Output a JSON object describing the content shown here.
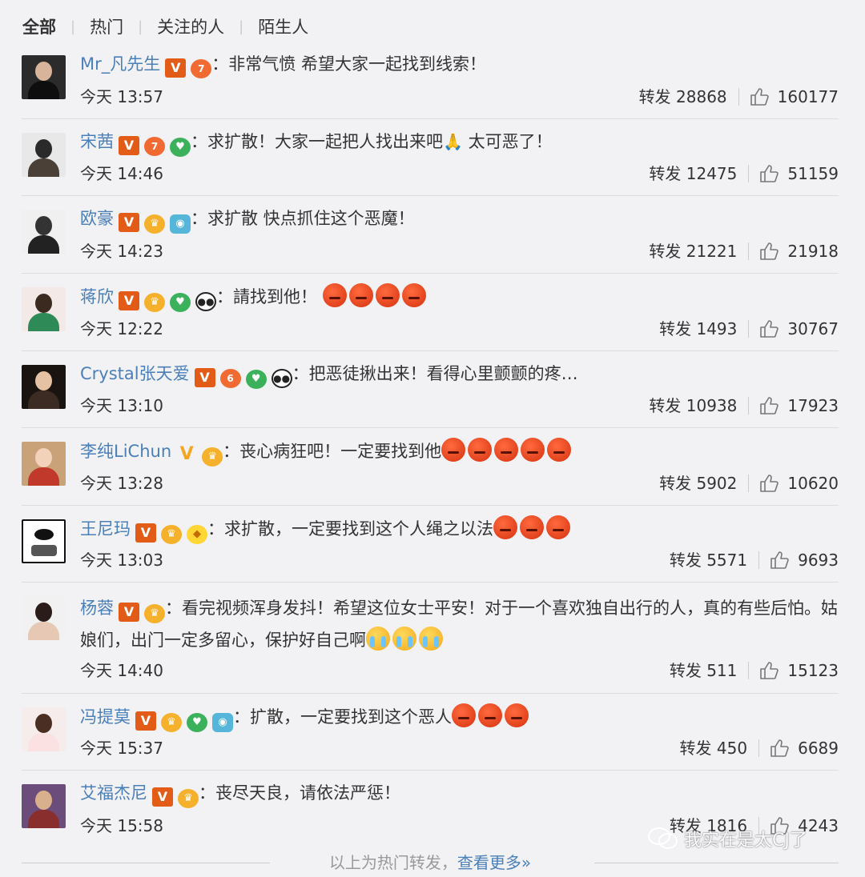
{
  "tabs": [
    "全部",
    "热门",
    "关注的人",
    "陌生人"
  ],
  "repost_label": "转发",
  "comments": [
    {
      "user": "Mr_凡先生",
      "text": "：非常气愤 希望大家一起找到线索！",
      "time": "今天 13:57",
      "reposts": "28868",
      "likes": "160177"
    },
    {
      "user": "宋茜",
      "text": "：求扩散！大家一起把人找出来吧",
      "text2": " 太可恶了！",
      "time": "今天 14:46",
      "reposts": "12475",
      "likes": "51159"
    },
    {
      "user": "欧豪",
      "text": "：求扩散 快点抓住这个恶魔！",
      "time": "今天 14:23",
      "reposts": "21221",
      "likes": "21918"
    },
    {
      "user": "蒋欣",
      "text": "：請找到他！",
      "time": "今天 12:22",
      "reposts": "1493",
      "likes": "30767"
    },
    {
      "user": "Crystal张天爱",
      "text": "：把恶徒揪出来！看得心里颤颤的疼…",
      "time": "今天 13:10",
      "reposts": "10938",
      "likes": "17923"
    },
    {
      "user": "李纯LiChun",
      "text": "：丧心病狂吧！一定要找到他",
      "time": "今天 13:28",
      "reposts": "5902",
      "likes": "10620"
    },
    {
      "user": "王尼玛",
      "text": "：求扩散，一定要找到这个人绳之以法",
      "time": "今天 13:03",
      "reposts": "5571",
      "likes": "9693"
    },
    {
      "user": "杨蓉",
      "text": "：看完视频浑身发抖！希望这位女士平安！对于一个喜欢独自出行的人，真的有些后怕。姑娘们，出门一定多留心，保护好自己啊",
      "time": "今天 14:40",
      "reposts": "511",
      "likes": "15123"
    },
    {
      "user": "冯提莫",
      "text": "：扩散，一定要找到这个恶人",
      "time": "今天 15:37",
      "reposts": "450",
      "likes": "6689"
    },
    {
      "user": "艾福杰尼",
      "text": "：丧尽天良，请依法严惩！",
      "time": "今天 15:58",
      "reposts": "1816",
      "likes": "4243"
    }
  ],
  "footer": {
    "text": "以上为热门转发，",
    "link": "查看更多»"
  },
  "watermark": "我实在是太CJ了",
  "colors": {
    "link": "#4a7fb8",
    "background": "#f2f2f5",
    "v_badge": "#e25c18"
  }
}
